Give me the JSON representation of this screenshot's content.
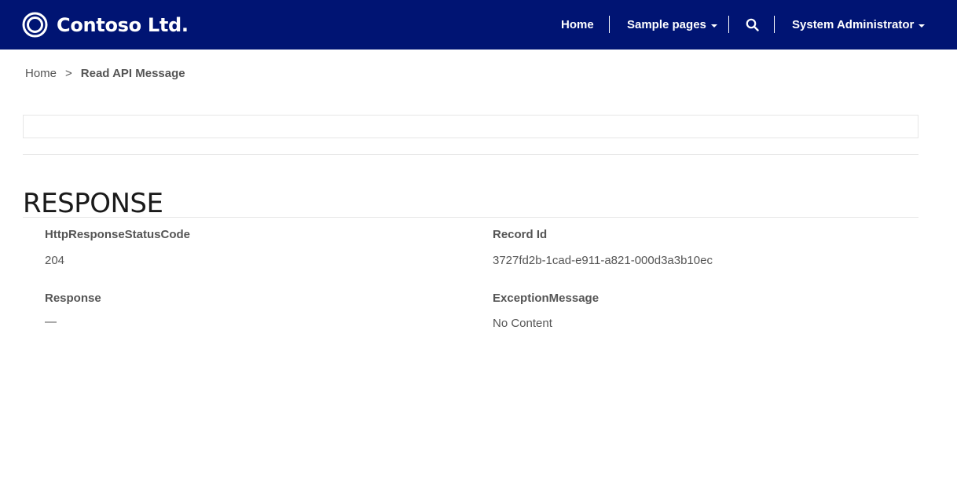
{
  "header": {
    "brand_name": "Contoso Ltd.",
    "background_color": "#001473",
    "logo_icon": "ring-logo-icon",
    "nav": {
      "home": "Home",
      "sample_pages": "Sample pages",
      "search_icon": "search-icon",
      "user": "System Administrator"
    }
  },
  "breadcrumb": {
    "home": "Home",
    "separator": ">",
    "current": "Read API Message"
  },
  "section": {
    "title": "RESPONSE"
  },
  "fields": {
    "status_code": {
      "label": "HttpResponseStatusCode",
      "value": "204"
    },
    "record_id": {
      "label": "Record Id",
      "value": "3727fd2b-1cad-e911-a821-000d3a3b10ec"
    },
    "response": {
      "label": "Response",
      "value": "—"
    },
    "exception_message": {
      "label": "ExceptionMessage",
      "value": "No Content"
    }
  }
}
